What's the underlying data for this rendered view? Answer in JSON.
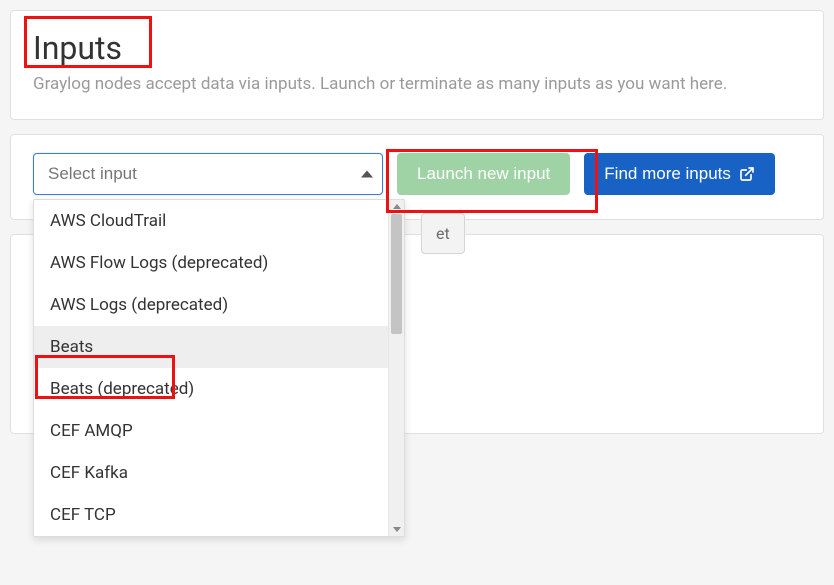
{
  "header": {
    "title": "Inputs",
    "description": "Graylog nodes accept data via inputs. Launch or terminate as many inputs as you want here."
  },
  "controls": {
    "select_placeholder": "Select input",
    "launch_label": "Launch new input",
    "find_label": "Find more inputs"
  },
  "dropdown_options": [
    "AWS CloudTrail",
    "AWS Flow Logs (deprecated)",
    "AWS Logs (deprecated)",
    "Beats",
    "Beats (deprecated)",
    "CEF AMQP",
    "CEF Kafka",
    "CEF TCP"
  ],
  "highlighted_option": "Beats",
  "partial_button_fragment": "et"
}
